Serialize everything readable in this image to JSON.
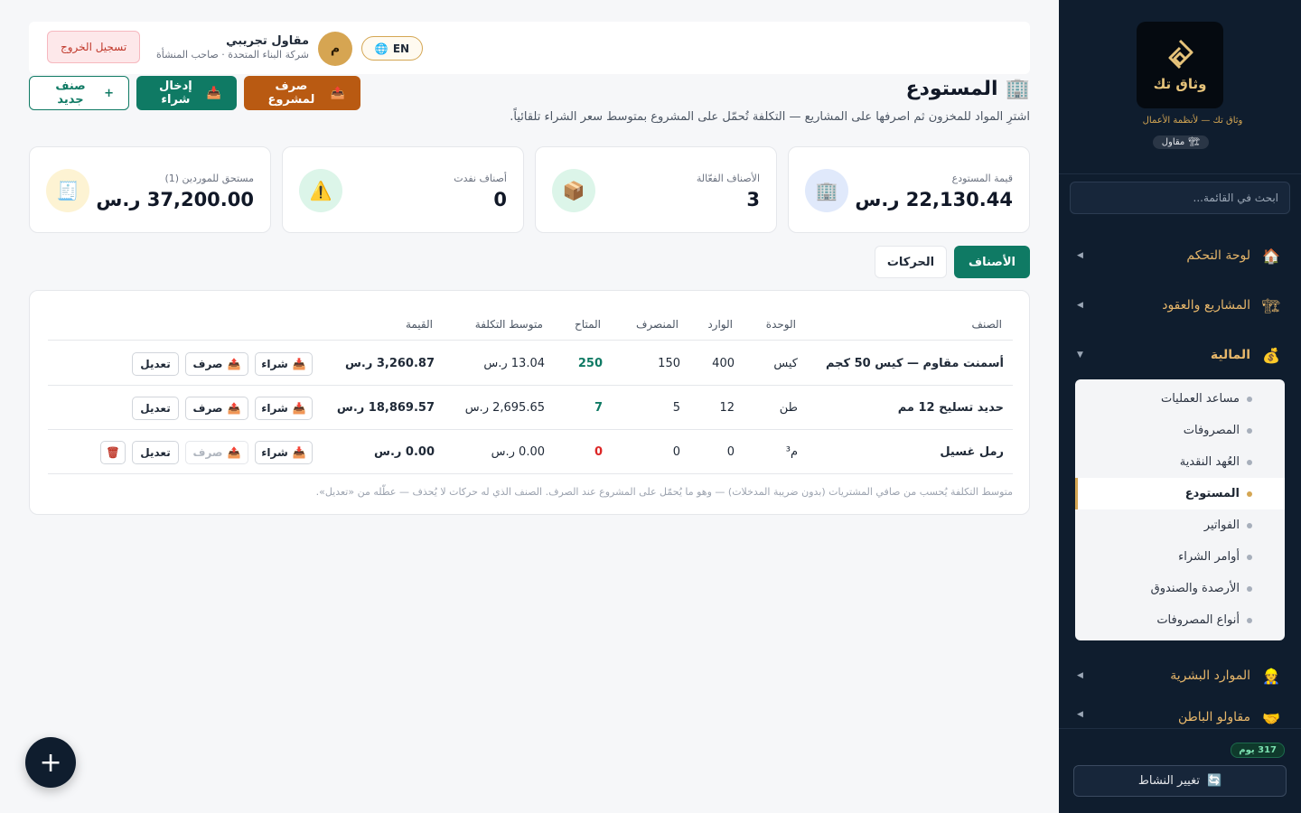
{
  "sidebar": {
    "brand": "وثاق تك",
    "tagline": "وثاق تك — لأنظمة الأعمال",
    "role_badge": "مقاول",
    "search_placeholder": "ابحث في القائمة...",
    "nav": [
      {
        "label": "لوحة التحكم",
        "icon": "🏠"
      },
      {
        "label": "المشاريع والعقود",
        "icon": "🏗"
      },
      {
        "label": "المالية",
        "icon": "💰"
      },
      {
        "label": "الموارد البشرية",
        "icon": "👷"
      },
      {
        "label": "مقاولو الباطن",
        "icon": "🤝"
      }
    ],
    "finance_sub": [
      {
        "label": "مساعد العمليات"
      },
      {
        "label": "المصروفات"
      },
      {
        "label": "العُهد النقدية"
      },
      {
        "label": "المستودع"
      },
      {
        "label": "الفواتير"
      },
      {
        "label": "أوامر الشراء"
      },
      {
        "label": "الأرصدة والصندوق"
      },
      {
        "label": "أنواع المصروفات"
      }
    ],
    "days_badge": "317 يوم",
    "switch_label": "تغيير النشاط"
  },
  "header": {
    "logout": "تسجيل الخروج",
    "user_name": "مقاول تجريبي",
    "user_sub": "شركة البناء المتحدة · صاحب المنشأة",
    "avatar_letter": "م",
    "lang": "EN"
  },
  "page": {
    "title": "المستودع",
    "description": "اشترِ المواد للمخزون ثم اصرفها على المشاريع — التكلفة تُحمّل على المشروع بمتوسط سعر الشراء تلقائياً.",
    "actions": {
      "issue": "صرف لمشروع",
      "purchase": "إدخال شراء",
      "new_item": "صنف جديد"
    }
  },
  "stats": [
    {
      "label": "قيمة المستودع",
      "value": "22,130.44 ر.س",
      "icon": "🏢",
      "color": "#e0e9fb"
    },
    {
      "label": "الأصناف الفعّالة",
      "value": "3",
      "icon": "📦",
      "color": "#dcf5e9"
    },
    {
      "label": "أصناف نفدت",
      "value": "0",
      "icon": "⚠️",
      "color": "#dcf5e9"
    },
    {
      "label": "مستحق للموردين (1)",
      "value": "37,200.00 ر.س",
      "icon": "🧾",
      "color": "#fdf3d3"
    }
  ],
  "tabs": {
    "items": "الأصناف",
    "movements": "الحركات"
  },
  "table": {
    "headers": {
      "item": "الصنف",
      "unit": "الوحدة",
      "incoming": "الوارد",
      "issued": "المنصرف",
      "available": "المتاح",
      "avg_cost": "متوسط التكلفة",
      "value": "القيمة"
    },
    "btn_labels": {
      "buy": "شراء",
      "issue": "صرف",
      "edit": "تعديل"
    },
    "rows": [
      {
        "item": "أسمنت مقاوم — كيس 50 كجم",
        "unit": "كيس",
        "incoming": "400",
        "issued": "150",
        "available": "250",
        "avg_cost": "13.04 ر.س",
        "value": "3,260.87 ر.س",
        "available_color": "#0f7a64"
      },
      {
        "item": "حديد تسليح 12 مم",
        "unit": "طن",
        "incoming": "12",
        "issued": "5",
        "available": "7",
        "avg_cost": "2,695.65 ر.س",
        "value": "18,869.57 ر.س",
        "available_color": "#0f7a64"
      },
      {
        "item": "رمل غسيل",
        "unit": "م³",
        "incoming": "0",
        "issued": "0",
        "available": "0",
        "avg_cost": "0.00 ر.س",
        "value": "0.00 ر.س",
        "available_color": "#dc2626"
      }
    ],
    "note": "متوسط التكلفة يُحسب من صافي المشتريات (بدون ضريبة المدخلات) — وهو ما يُحمّل على المشروع عند الصرف. الصنف الذي له حركات لا يُحذف — عطّله من «تعديل»."
  }
}
